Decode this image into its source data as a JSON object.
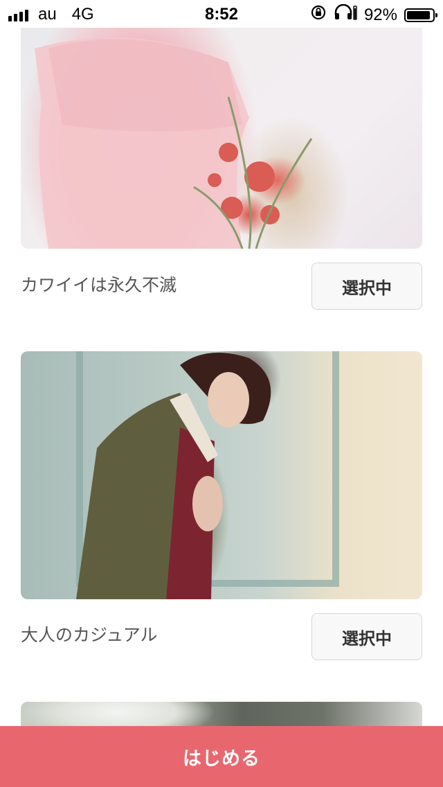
{
  "status_bar": {
    "carrier": "au",
    "network": "4G",
    "time": "8:52",
    "battery_percent": "92%",
    "battery_level": 0.92,
    "icons": [
      "signal-icon",
      "orientation-lock-icon",
      "headphones-icon",
      "battery-icon"
    ]
  },
  "styles": [
    {
      "caption": "カワイイは永久不滅",
      "button_label": "選択中",
      "image": "pink-lace-dress-with-dried-flowers"
    },
    {
      "caption": "大人のカジュアル",
      "button_label": "選択中",
      "image": "woman-in-olive-bomber-jacket"
    },
    {
      "caption": "",
      "button_label": "",
      "image": "white-flowers-partially-visible"
    }
  ],
  "footer": {
    "start_label": "はじめる",
    "accent_color": "#e8676f"
  }
}
